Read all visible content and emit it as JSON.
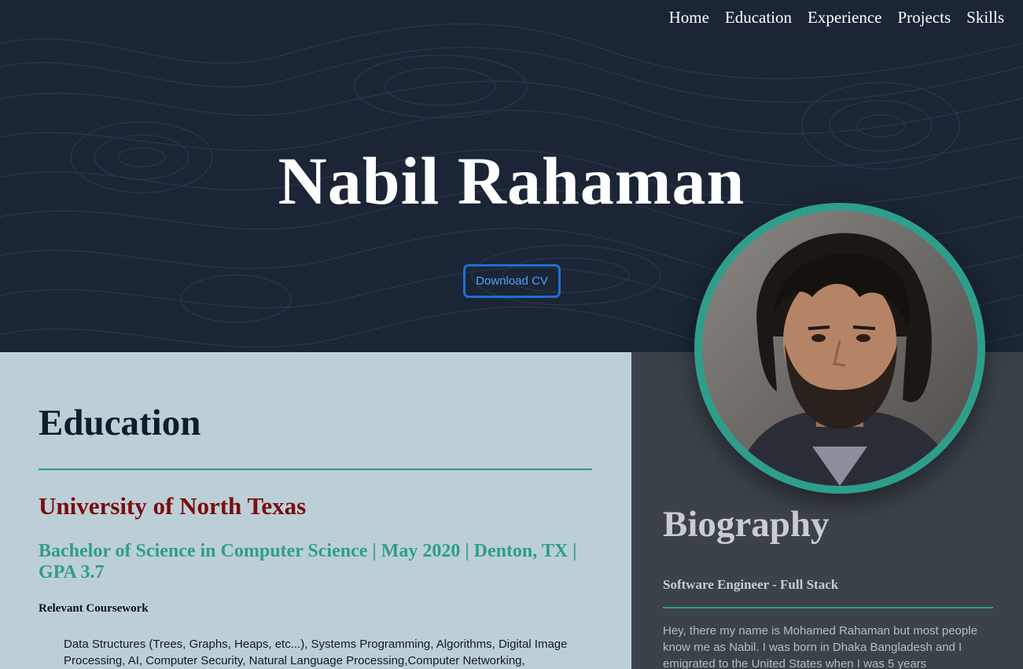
{
  "nav": {
    "items": [
      "Home",
      "Education",
      "Experience",
      "Projects",
      "Skills"
    ]
  },
  "hero": {
    "name": "Nabil Rahaman",
    "cv_button": "Download CV"
  },
  "education": {
    "title": "Education",
    "university": "University of North Texas",
    "degree": "Bachelor of Science in Computer Science | May 2020 | Denton, TX | GPA 3.7",
    "coursework_label": "Relevant Coursework",
    "coursework": "Data Structures (Trees, Graphs, Heaps, etc...), Systems Programming, Algorithms, Digital Image Processing, AI, Computer Security, Natural Language Processing,Computer Networking,"
  },
  "biography": {
    "title": "Biography",
    "role": "Software Engineer - Full Stack",
    "text": "Hey, there my name is Mohamed Rahaman but most people know me as Nabil. I was born in Dhaka Bangladesh and I emigrated to the United States when I was 5 years"
  },
  "colors": {
    "accent": "#2e9e8a",
    "university": "#7a0d10",
    "button_border": "#1e6fd6",
    "hero_bg": "#1b2535"
  },
  "avatar": {
    "icon": "profile-photo"
  }
}
